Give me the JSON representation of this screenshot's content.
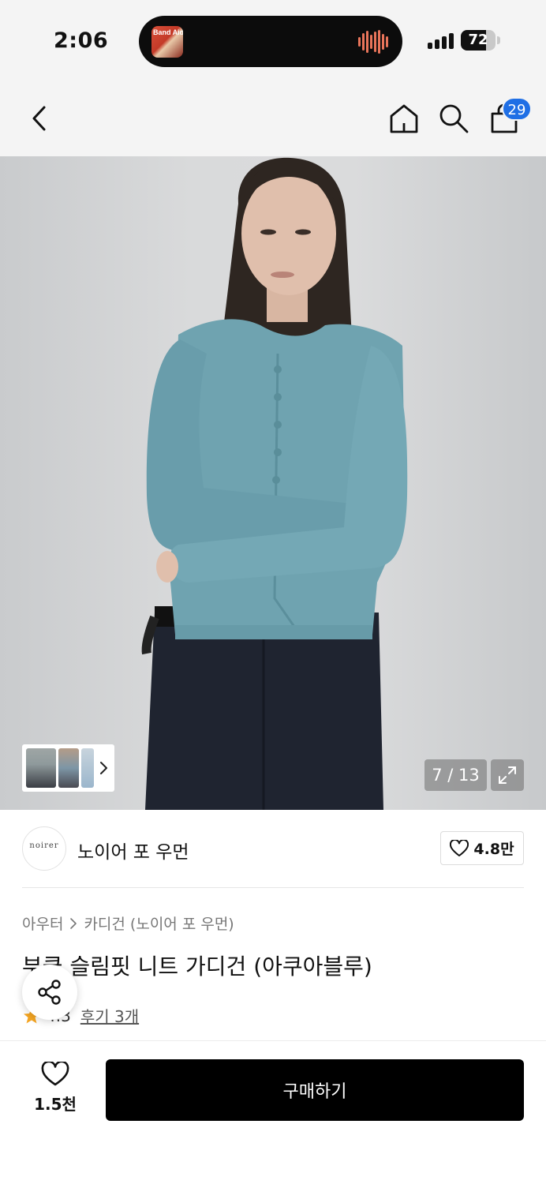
{
  "status_bar": {
    "time": "2:06",
    "album_text": "Band Aid",
    "battery": "72",
    "battery_level": 0.72
  },
  "nav": {
    "cart_count": "29",
    "icons": [
      "back-icon",
      "home-icon",
      "search-icon",
      "shopping-bag-icon"
    ]
  },
  "gallery": {
    "counter": "7 / 13"
  },
  "brand": {
    "logo_text": "noirer",
    "name": "노이어 포 우먼",
    "like_count": "4.8만"
  },
  "product": {
    "breadcrumb": [
      "아우터",
      "카디건 (노이어 포 우먼)"
    ],
    "title": "부클 슬림핏 니트 가디건 (아쿠아블루)",
    "rating": "4.3",
    "review_link": "후기 3개"
  },
  "bottom_bar": {
    "wish_count": "1.5천",
    "buy_label": "구매하기"
  },
  "colors": {
    "accent_badge": "#1f6fe5",
    "buy_button": "#000000",
    "star": "#f5a623",
    "cardigan": "#6fa3b0"
  }
}
